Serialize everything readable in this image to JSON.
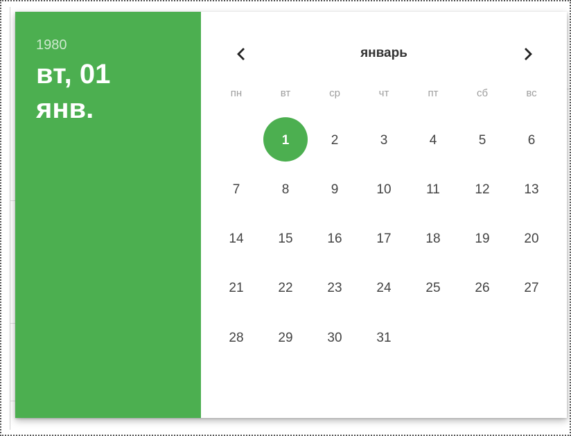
{
  "header": {
    "year": "1980",
    "selected_date": "вт, 01 янв."
  },
  "calendar": {
    "month": "январь",
    "prev_icon": "chevron-left-icon",
    "next_icon": "chevron-right-icon",
    "weekdays": [
      "пн",
      "вт",
      "ср",
      "чт",
      "пт",
      "сб",
      "вс"
    ],
    "leading_blanks": 1,
    "days": [
      "1",
      "2",
      "3",
      "4",
      "5",
      "6",
      "7",
      "8",
      "9",
      "10",
      "11",
      "12",
      "13",
      "14",
      "15",
      "16",
      "17",
      "18",
      "19",
      "20",
      "21",
      "22",
      "23",
      "24",
      "25",
      "26",
      "27",
      "28",
      "29",
      "30",
      "31"
    ],
    "selected_day": "1"
  },
  "colors": {
    "accent": "#4caf50",
    "text": "#424242",
    "weekday_text": "#9e9e9e"
  }
}
